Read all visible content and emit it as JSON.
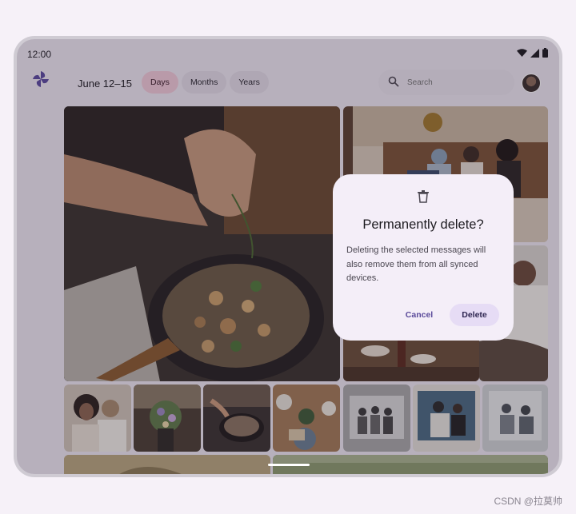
{
  "status_bar": {
    "time": "12:00"
  },
  "app_bar": {
    "date_range": "June 12–15",
    "chips": [
      {
        "label": "Days",
        "selected": true
      },
      {
        "label": "Months",
        "selected": false
      },
      {
        "label": "Years",
        "selected": false
      }
    ],
    "search": {
      "placeholder": "Search"
    }
  },
  "dialog": {
    "icon": "trash-icon",
    "title": "Permanently delete?",
    "body": "Deleting the selected messages will also remove them from all synced devices.",
    "cancel_label": "Cancel",
    "confirm_label": "Delete"
  },
  "photos": [
    {
      "name": "photo-cooking-hero",
      "palette": [
        "#3b352e",
        "#6d4f34",
        "#2a2422"
      ]
    },
    {
      "name": "photo-group-sofa",
      "palette": [
        "#c9b7a6",
        "#7a5e44",
        "#3a2a22"
      ]
    },
    {
      "name": "photo-friends-outdoors",
      "palette": [
        "#8c8880",
        "#d9d5cf",
        "#5a5550"
      ]
    },
    {
      "name": "photo-dining-table",
      "palette": [
        "#7a5940",
        "#c9a27a",
        "#3e2e25"
      ]
    },
    {
      "name": "thumb-couple",
      "palette": [
        "#c8bcaf",
        "#3a2d26",
        "#8e6c57"
      ]
    },
    {
      "name": "thumb-flowers",
      "palette": [
        "#4c5a3e",
        "#a58f6f",
        "#2e2a26"
      ]
    },
    {
      "name": "thumb-pan",
      "palette": [
        "#3b3430",
        "#7f6f63",
        "#1e1a18"
      ]
    },
    {
      "name": "thumb-table-top",
      "palette": [
        "#a07a55",
        "#d8c7a8",
        "#55683e"
      ]
    },
    {
      "name": "thumb-bw-group",
      "palette": [
        "#b5b5b5",
        "#5d5d5d",
        "#2a2a2a"
      ]
    },
    {
      "name": "thumb-blue-sofa",
      "palette": [
        "#6d8fa4",
        "#e8e6df",
        "#2f3a40"
      ]
    },
    {
      "name": "thumb-bw-sketch",
      "palette": [
        "#d3d5d5",
        "#8a9094",
        "#3f4448"
      ]
    },
    {
      "name": "photo-bottom-left",
      "palette": [
        "#c3b187",
        "#8b7a55"
      ]
    },
    {
      "name": "photo-bottom-right",
      "palette": [
        "#8a9a6e",
        "#b6bfa1"
      ]
    }
  ],
  "watermark": "CSDN @拉莫帅"
}
